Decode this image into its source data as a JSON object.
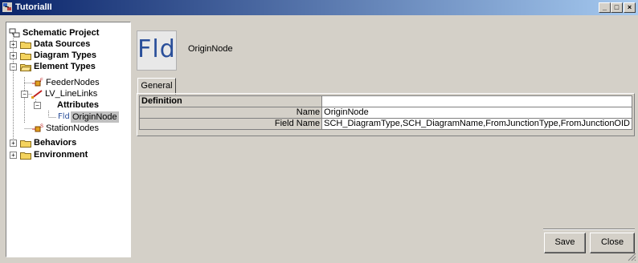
{
  "window": {
    "title": "TutorialII",
    "minimize": "_",
    "maximize": "□",
    "close": "×"
  },
  "tree": {
    "root": "Schematic Project",
    "data_sources": "Data Sources",
    "diagram_types": "Diagram Types",
    "element_types": "Element Types",
    "feeder_nodes": "FeederNodes",
    "lv_linelinks": "LV_LineLinks",
    "attributes": "Attributes",
    "fld_prefix": "Fld",
    "origin_node": "OriginNode",
    "station_nodes": "StationNodes",
    "behaviors": "Behaviors",
    "environment": "Environment",
    "plus": "+",
    "minus": "−"
  },
  "header": {
    "icon_text": "Fld",
    "name": "OriginNode"
  },
  "tabs": {
    "general": "General"
  },
  "properties": {
    "section": "Definition",
    "rows": [
      {
        "key": "Name",
        "value": "OriginNode"
      },
      {
        "key": "Field Name",
        "value": "SCH_DiagramType,SCH_DiagramName,FromJunctionType,FromJunctionOID"
      }
    ]
  },
  "buttons": {
    "save": "Save",
    "close": "Close"
  },
  "colors": {
    "titlebar_start": "#0a246a",
    "titlebar_end": "#a6caf0",
    "folder": "#f4d35e",
    "fld_text": "#2a4f9a"
  }
}
